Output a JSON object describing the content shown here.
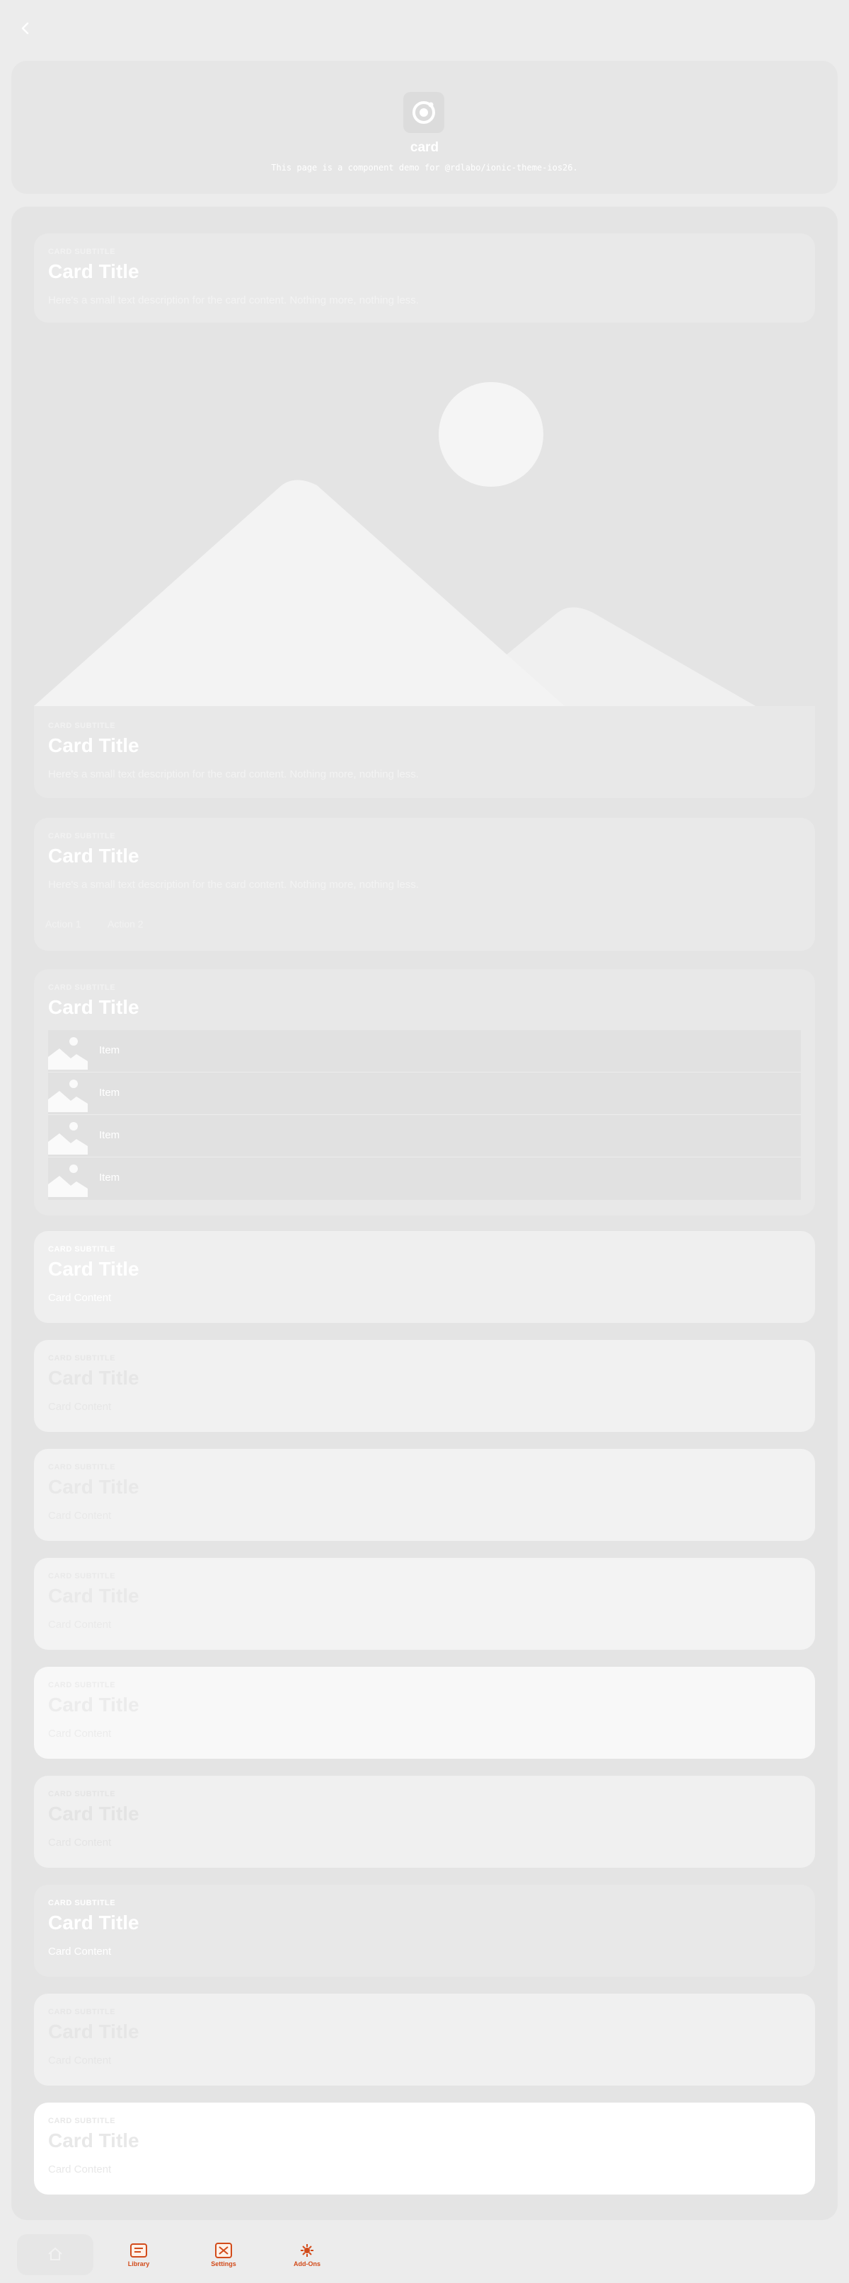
{
  "header": {
    "title": "card",
    "description": "This page is a component demo for @rdlabo/ionic-theme-ios26."
  },
  "cards": {
    "basic": {
      "subtitle": "Card Subtitle",
      "title": "Card Title",
      "content": "Here's a small text description for the card content. Nothing more, nothing less."
    },
    "media": {
      "subtitle": "Card Subtitle",
      "title": "Card Title",
      "content": "Here's a small text description for the card content. Nothing more, nothing less."
    },
    "actions": {
      "subtitle": "Card Subtitle",
      "title": "Card Title",
      "content": "Here's a small text description for the card content. Nothing more, nothing less.",
      "button1": "Action 1",
      "button2": "Action 2"
    },
    "list": {
      "subtitle": "Card Subtitle",
      "title": "Card Title",
      "items": [
        "Item",
        "Item",
        "Item",
        "Item"
      ]
    },
    "colored": [
      {
        "subtitle": "Card Subtitle",
        "title": "Card Title",
        "content": "Card Content",
        "color": "#efefef",
        "text": "#ffffff"
      },
      {
        "subtitle": "Card Subtitle",
        "title": "Card Title",
        "content": "Card Content",
        "color": "#f1f1f1",
        "text": "#e6e6e6"
      },
      {
        "subtitle": "Card Subtitle",
        "title": "Card Title",
        "content": "Card Content",
        "color": "#f2f2f2",
        "text": "#e8e8e8"
      },
      {
        "subtitle": "Card Subtitle",
        "title": "Card Title",
        "content": "Card Content",
        "color": "#f3f3f3",
        "text": "#e9e9e9"
      },
      {
        "subtitle": "Card Subtitle",
        "title": "Card Title",
        "content": "Card Content",
        "color": "#f8f8f8",
        "text": "#ececec"
      },
      {
        "subtitle": "Card Subtitle",
        "title": "Card Title",
        "content": "Card Content",
        "color": "#f0f0f0",
        "text": "#e4e4e4"
      },
      {
        "subtitle": "Card Subtitle",
        "title": "Card Title",
        "content": "Card Content",
        "color": "#e8e8e8",
        "text": "#ffffff"
      },
      {
        "subtitle": "Card Subtitle",
        "title": "Card Title",
        "content": "Card Content",
        "color": "#f0f0f0",
        "text": "#e6e6e6"
      },
      {
        "subtitle": "Card Subtitle",
        "title": "Card Title",
        "content": "Card Content",
        "color": "#ffffff",
        "text": "#e8e8e8"
      }
    ]
  },
  "bottom_nav": {
    "tabs": [
      {
        "label": "",
        "icon": "home-icon",
        "active": true
      },
      {
        "label": "Library",
        "icon": "library-icon",
        "active": false
      },
      {
        "label": "Settings",
        "icon": "settings-icon",
        "active": false
      },
      {
        "label": "Add-Ons",
        "icon": "addons-icon",
        "active": false
      }
    ],
    "accent": "#d24b1a"
  }
}
